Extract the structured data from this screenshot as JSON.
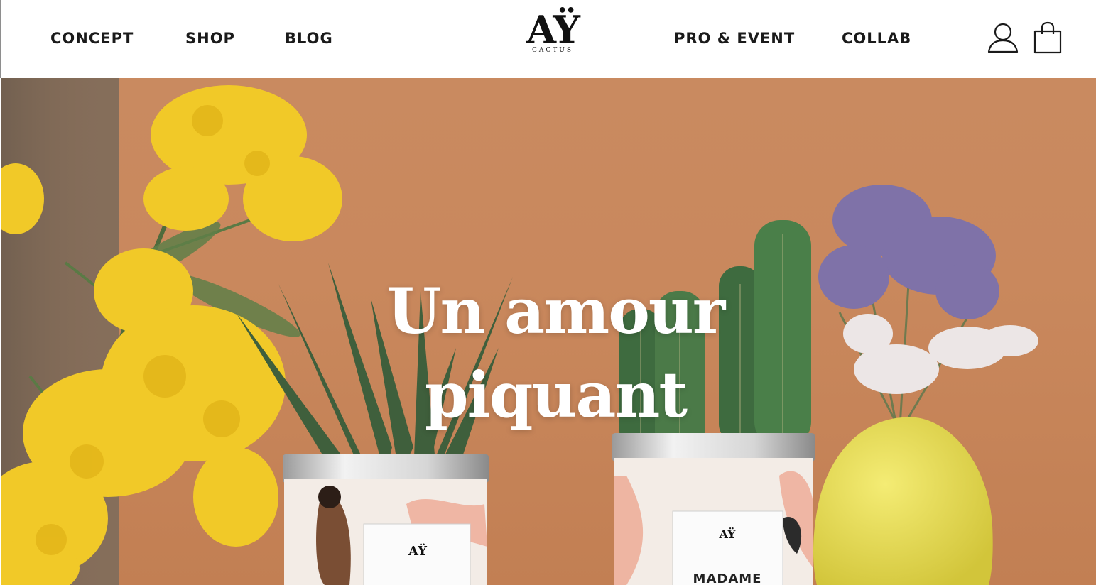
{
  "nav": {
    "left": [
      "CONCEPT",
      "SHOP",
      "BLOG"
    ],
    "right": [
      "PRO & EVENT",
      "COLLAB"
    ]
  },
  "logo": {
    "mark": "AŸ",
    "subtitle": "CACTUS"
  },
  "icons": {
    "account": "user-icon",
    "cart": "shopping-bag-icon"
  },
  "hero": {
    "headline_line1": "Un amour",
    "headline_line2": "piquant",
    "pot_label_left": "AŸ",
    "pot_label_right_logo": "AŸ",
    "pot_label_right_text": "MADAME"
  },
  "colors": {
    "background": "#c98a60",
    "text_dark": "#1a1a1a",
    "headline": "#ffffff"
  }
}
